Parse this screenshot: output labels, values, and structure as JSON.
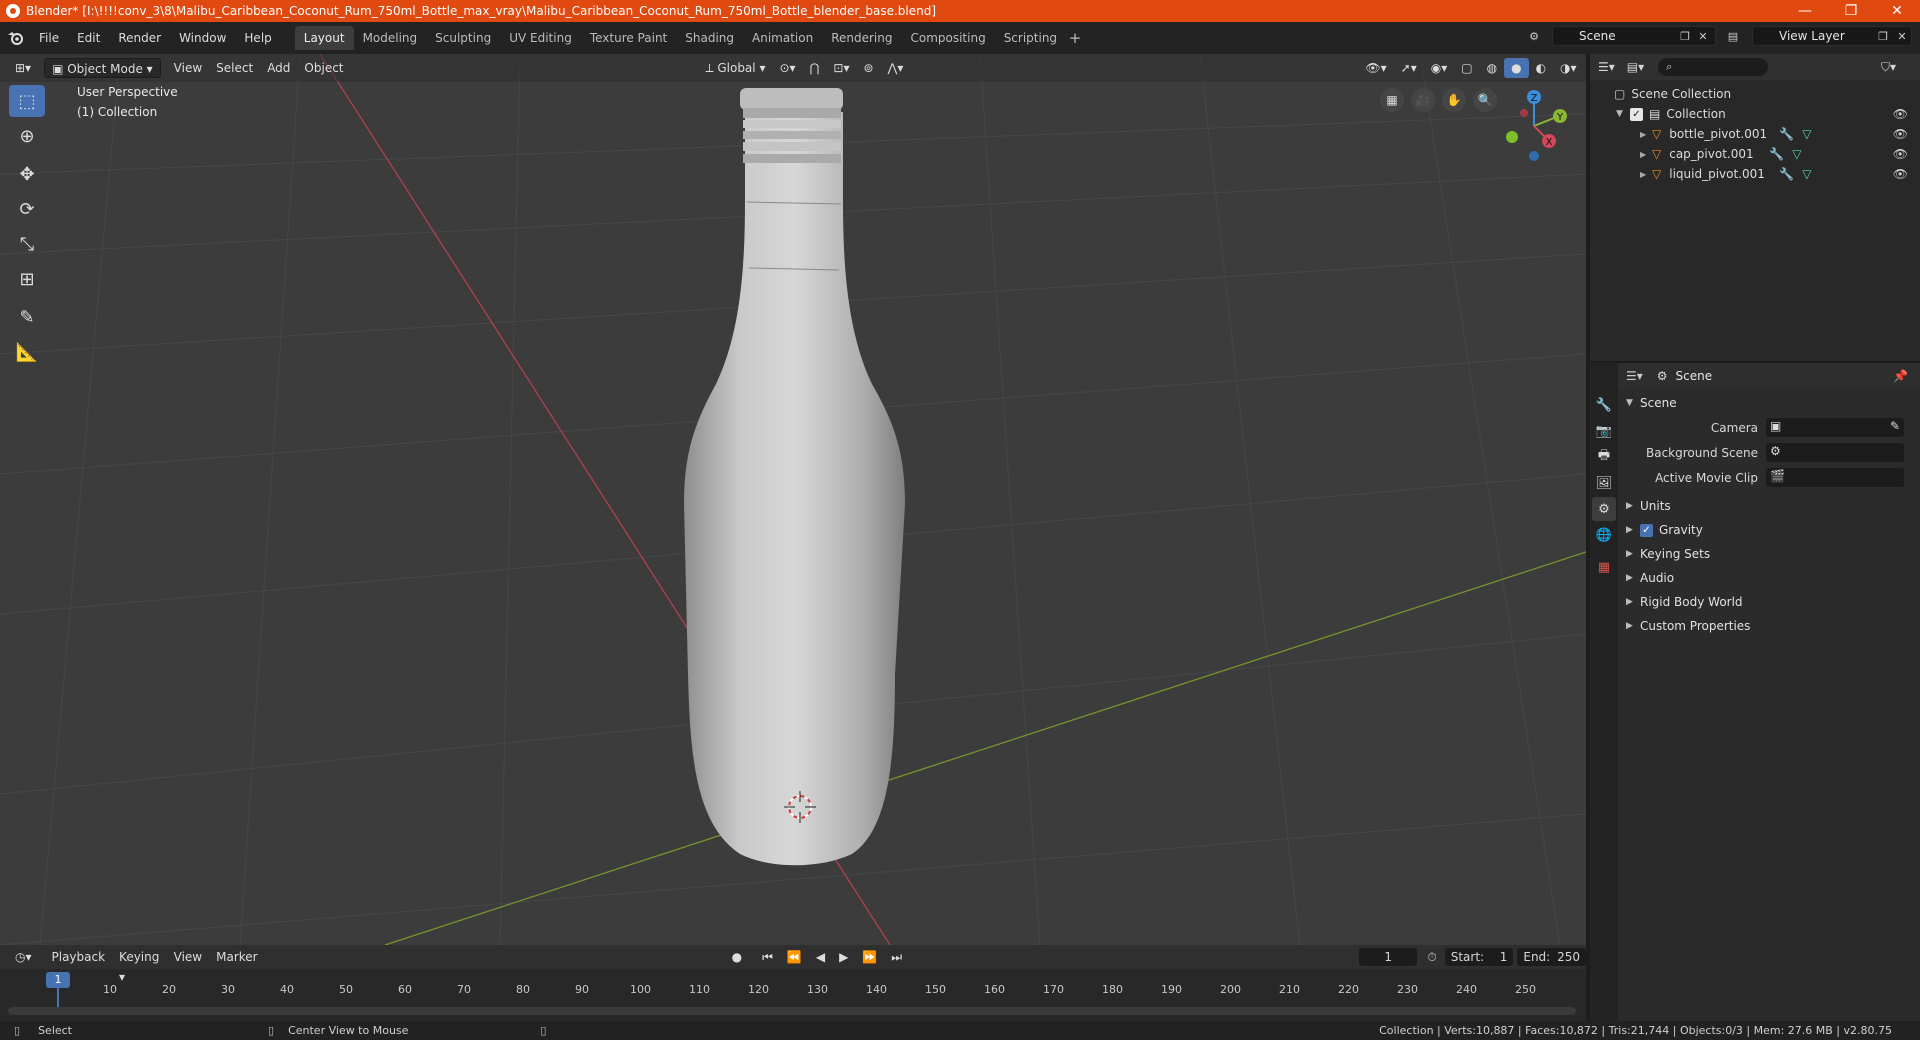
{
  "window": {
    "title": "Blender* [I:\\!!!!conv_3\\8\\Malibu_Caribbean_Coconut_Rum_750ml_Bottle_max_vray\\Malibu_Caribbean_Coconut_Rum_750ml_Bottle_blender_base.blend]",
    "minimize": "—",
    "maximize": "❐",
    "close": "✕"
  },
  "menu": {
    "items": [
      "File",
      "Edit",
      "Render",
      "Window",
      "Help"
    ]
  },
  "workspaces": {
    "tabs": [
      "Layout",
      "Modeling",
      "Sculpting",
      "UV Editing",
      "Texture Paint",
      "Shading",
      "Animation",
      "Rendering",
      "Compositing",
      "Scripting"
    ],
    "active": "Layout",
    "add": "+"
  },
  "scene_selector": {
    "value": "Scene"
  },
  "view_layer_selector": {
    "value": "View Layer"
  },
  "viewport": {
    "mode": "Object Mode",
    "menus": [
      "View",
      "Select",
      "Add",
      "Object"
    ],
    "orientation": "Global",
    "overlay_line1": "User Perspective",
    "overlay_line2": "(1) Collection",
    "gizmo": {
      "x": "X",
      "y": "Y",
      "z": "Z"
    }
  },
  "outliner": {
    "root": "Scene Collection",
    "collection": "Collection",
    "objects": [
      "bottle_pivot.001",
      "cap_pivot.001",
      "liquid_pivot.001"
    ]
  },
  "properties": {
    "header": "Scene",
    "section": "Scene",
    "fields": {
      "camera": "Camera",
      "background_scene": "Background Scene",
      "active_movie_clip": "Active Movie Clip"
    },
    "panels": [
      "Units",
      "Gravity",
      "Keying Sets",
      "Audio",
      "Rigid Body World",
      "Custom Properties"
    ]
  },
  "timeline": {
    "menus": [
      "Playback",
      "Keying",
      "View",
      "Marker"
    ],
    "current_frame": "1",
    "start_label": "Start:",
    "start": "1",
    "end_label": "End:",
    "end": "250",
    "ruler": [
      "1",
      "10",
      "20",
      "30",
      "40",
      "50",
      "60",
      "70",
      "80",
      "90",
      "100",
      "110",
      "120",
      "130",
      "140",
      "150",
      "160",
      "170",
      "180",
      "190",
      "200",
      "210",
      "220",
      "230",
      "240",
      "250"
    ]
  },
  "status": {
    "left1": "Select",
    "left2": "Center View to Mouse",
    "right": "Collection | Verts:10,887 | Faces:10,872 | Tris:21,744 | Objects:0/3 | Mem: 27.6 MB | v2.80.75"
  },
  "colors": {
    "title_bar": "#e04a10",
    "accent": "#4772b3",
    "viewport_bg": "#3c3c3c",
    "x_axis": "#d0485a",
    "y_axis": "#8ab734",
    "z_axis": "#3b8ee0"
  }
}
